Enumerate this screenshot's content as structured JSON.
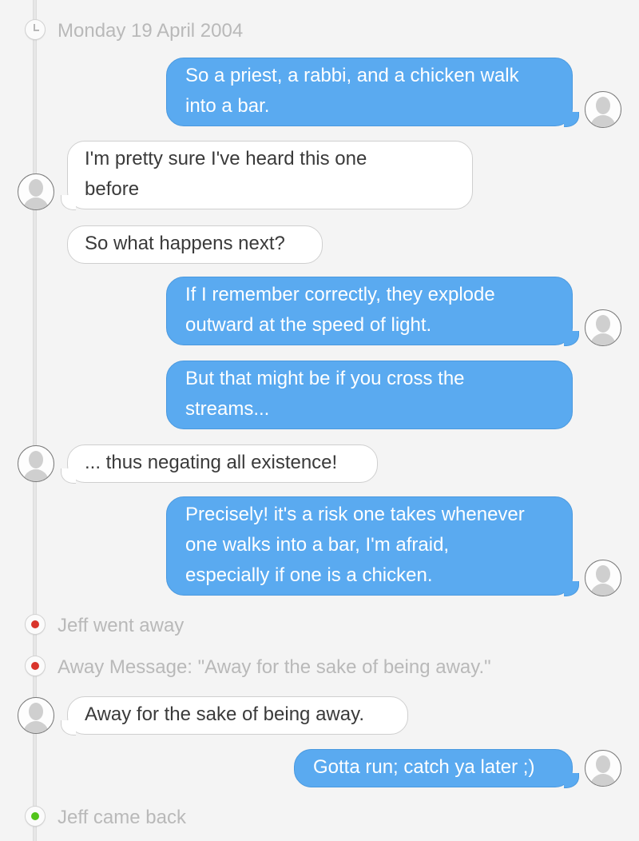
{
  "date_header": "Monday 19 April 2004",
  "messages": [
    {
      "sender": "me",
      "text_lines": [
        "So a priest, a rabbi, and a chicken walk",
        "into a bar."
      ]
    },
    {
      "sender": "jeff",
      "text_lines": [
        "I'm pretty sure I've heard this one",
        "before"
      ]
    },
    {
      "sender": "jeff",
      "text_lines": [
        "So what happens next?"
      ]
    },
    {
      "sender": "me",
      "text_lines": [
        "If I remember correctly, they explode",
        "outward at the speed of light."
      ]
    },
    {
      "sender": "me",
      "text_lines": [
        "But that might be if you cross the",
        "streams..."
      ]
    },
    {
      "sender": "jeff",
      "text_lines": [
        "... thus negating all existence!"
      ]
    },
    {
      "sender": "me",
      "text_lines": [
        "Precisely! it's a risk one takes whenever",
        "one walks into a bar, I'm afraid,",
        "especially if one is a chicken."
      ]
    },
    {
      "sender": "jeff",
      "text_lines": [
        "Away for the sake of being away."
      ]
    },
    {
      "sender": "me",
      "text_lines": [
        "Gotta run; catch ya later ;)"
      ]
    }
  ],
  "events": [
    {
      "type": "away",
      "text": "Jeff went away",
      "color": "#d9342b"
    },
    {
      "type": "away-message",
      "text": "Away Message: \"Away for the sake of being away.\"",
      "color": "#d9342b"
    },
    {
      "type": "back",
      "text": "Jeff came back",
      "color": "#52c41a"
    }
  ],
  "colors": {
    "outgoing_bubble": "#5aaaf0",
    "incoming_bubble": "#ffffff",
    "event_text": "#b9b9b9",
    "background": "#f4f4f4"
  },
  "icons": {
    "date_marker": "clock-icon",
    "avatar": "default-user-avatar-icon"
  }
}
